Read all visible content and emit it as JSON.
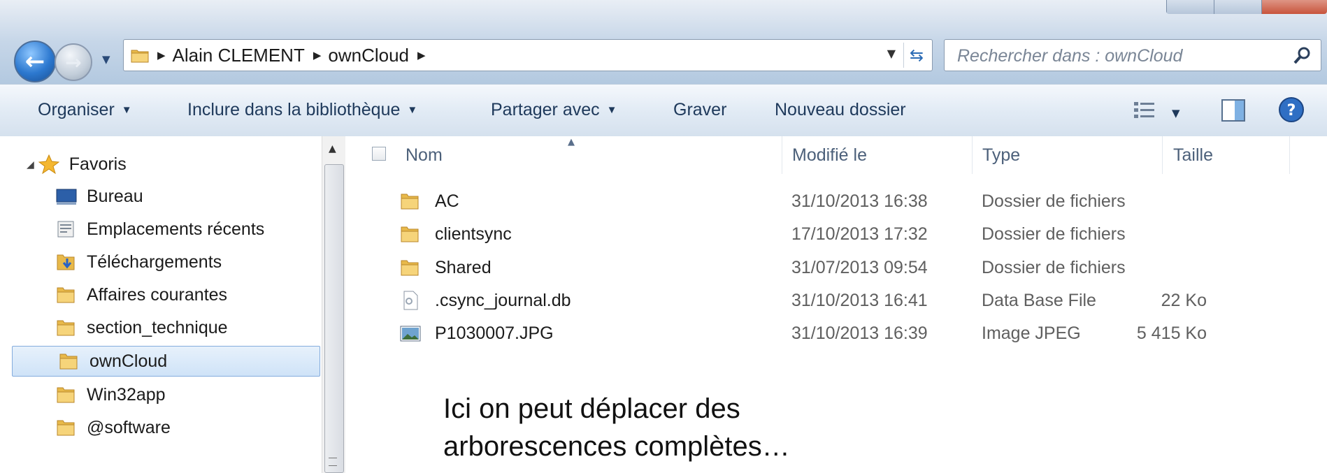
{
  "address": {
    "crumbs": [
      "Alain CLEMENT",
      "ownCloud"
    ]
  },
  "search": {
    "placeholder": "Rechercher dans : ownCloud"
  },
  "toolbar": {
    "organiser": "Organiser",
    "include": "Inclure dans la bibliothèque",
    "share": "Partager avec",
    "burn": "Graver",
    "new_folder": "Nouveau dossier"
  },
  "sidebar": {
    "favorites": "Favoris",
    "items": [
      {
        "label": "Bureau",
        "icon": "desktop-icon"
      },
      {
        "label": "Emplacements récents",
        "icon": "recent-places-icon"
      },
      {
        "label": "Téléchargements",
        "icon": "downloads-folder-icon"
      },
      {
        "label": "Affaires courantes",
        "icon": "folder-icon"
      },
      {
        "label": "section_technique",
        "icon": "folder-icon"
      },
      {
        "label": "ownCloud",
        "icon": "folder-icon",
        "selected": true
      },
      {
        "label": "Win32app",
        "icon": "folder-icon"
      },
      {
        "label": "@software",
        "icon": "folder-icon"
      }
    ]
  },
  "columns": {
    "name": "Nom",
    "modified": "Modifié le",
    "type": "Type",
    "size": "Taille"
  },
  "files": [
    {
      "name": "AC",
      "modified": "31/10/2013 16:38",
      "type": "Dossier de fichiers",
      "size": "",
      "icon": "folder-icon"
    },
    {
      "name": "clientsync",
      "modified": "17/10/2013 17:32",
      "type": "Dossier de fichiers",
      "size": "",
      "icon": "folder-icon"
    },
    {
      "name": "Shared",
      "modified": "31/07/2013 09:54",
      "type": "Dossier de fichiers",
      "size": "",
      "icon": "folder-icon"
    },
    {
      "name": ".csync_journal.db",
      "modified": "31/10/2013 16:41",
      "type": "Data Base File",
      "size": "22 Ko",
      "icon": "file-icon"
    },
    {
      "name": "P1030007.JPG",
      "modified": "31/10/2013 16:39",
      "type": "Image JPEG",
      "size": "5 415 Ko",
      "icon": "image-icon"
    }
  ],
  "caption": {
    "line1": "Ici on peut déplacer des",
    "line2": "arborescences complètes…"
  }
}
